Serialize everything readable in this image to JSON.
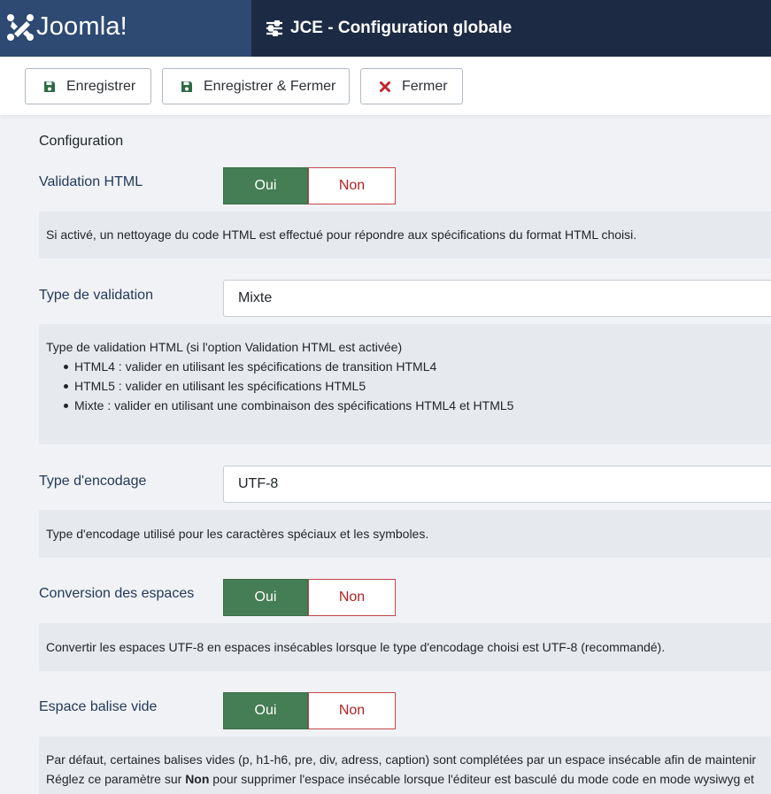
{
  "header": {
    "brand": "Joomla!",
    "title": "JCE - Configuration globale"
  },
  "toolbar": {
    "save_label": "Enregistrer",
    "save_close_label": "Enregistrer & Fermer",
    "close_label": "Fermer"
  },
  "section_title": "Configuration",
  "fields": {
    "html_validation": {
      "label": "Validation HTML",
      "yes": "Oui",
      "no": "Non",
      "selected": "Oui",
      "desc": "Si activé, un nettoyage du code HTML est effectué pour répondre aux spécifications du format HTML choisi."
    },
    "validation_type": {
      "label": "Type de validation",
      "value": "Mixte",
      "desc_intro": "Type de validation HTML (si l'option Validation HTML est activée)",
      "desc_items": [
        "HTML4 : valider en utilisant les spécifications de transition HTML4",
        "HTML5 : valider en utilisant les spécifications HTML5",
        "Mixte : valider en utilisant une combinaison des spécifications HTML4 et HTML5"
      ]
    },
    "encoding_type": {
      "label": "Type d'encodage",
      "value": "UTF-8",
      "desc": "Type d'encodage utilisé pour les caractères spéciaux et les symboles."
    },
    "space_conversion": {
      "label": "Conversion des espaces",
      "yes": "Oui",
      "no": "Non",
      "selected": "Oui",
      "desc": "Convertir les espaces UTF-8 en espaces insécables lorsque le type d'encodage choisi est UTF-8 (recommandé)."
    },
    "empty_tag_space": {
      "label": "Espace balise vide",
      "yes": "Oui",
      "no": "Non",
      "selected": "Oui",
      "desc_line1": "Par défaut, certaines balises vides (p, h1-h6, pre, div, adress, caption) sont complétées par un espace insécable afin de maintenir",
      "desc_line2_pre": "Réglez ce paramètre sur ",
      "desc_line2_bold": "Non",
      "desc_line2_post": " pour supprimer l'espace insécable lorsque l'éditeur est basculé du mode code en mode wysiwyg et"
    }
  },
  "colors": {
    "header_bg": "#1c2a44",
    "brand_bg": "#2e4a73",
    "yes_active": "#457d54",
    "no_text": "#b22222",
    "label_color": "#243a5a"
  },
  "icons": {
    "brand": "joomla-logo-icon",
    "title": "sliders-icon",
    "save": "save-icon",
    "save_close": "save-icon",
    "close": "close-icon"
  }
}
